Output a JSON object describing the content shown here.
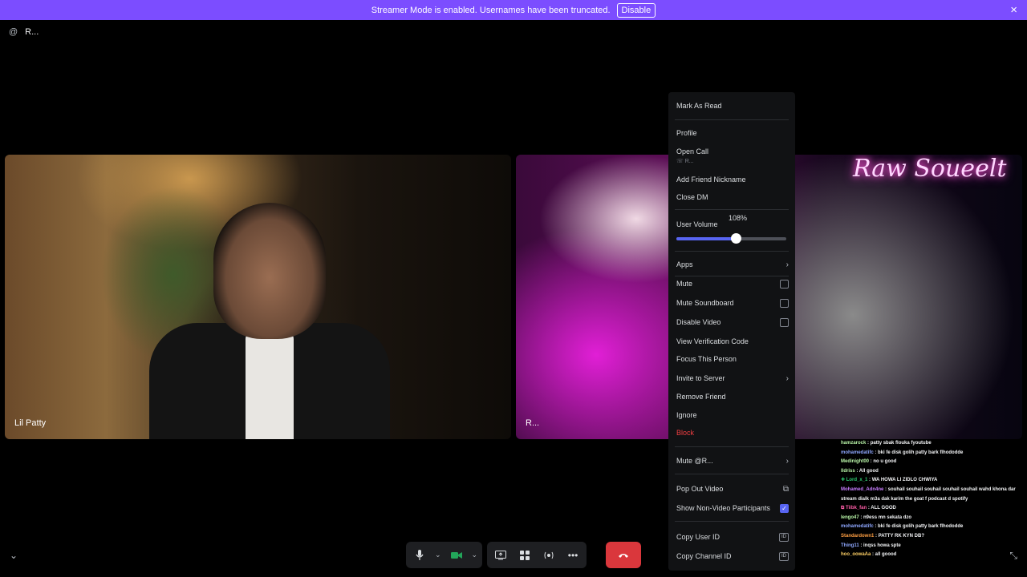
{
  "banner": {
    "message": "Streamer Mode is enabled. Usernames have been truncated.",
    "disable_label": "Disable",
    "close_icon": "×"
  },
  "dm_header": {
    "icon": "@",
    "name": "R..."
  },
  "tiles": [
    {
      "label": "Lil Patty"
    },
    {
      "label": "R...",
      "neon_sign": "Raw Soueelt"
    }
  ],
  "menu": {
    "mark_as_read": "Mark As Read",
    "profile": "Profile",
    "open_call": "Open Call",
    "open_call_sub": "R...",
    "add_friend_nickname": "Add Friend Nickname",
    "close_dm": "Close DM",
    "user_volume": "User Volume",
    "volume_value": "108%",
    "volume_fraction": 0.54,
    "apps": "Apps",
    "mute": "Mute",
    "mute_soundboard": "Mute Soundboard",
    "disable_video": "Disable Video",
    "view_verification_code": "View Verification Code",
    "focus_this_person": "Focus This Person",
    "invite_to_server": "Invite to Server",
    "remove_friend": "Remove Friend",
    "ignore": "Ignore",
    "block": "Block",
    "mute_user": "Mute @R...",
    "pop_out_video": "Pop Out Video",
    "show_non_video": "Show Non-Video Participants",
    "show_non_video_checked": true,
    "copy_user_id": "Copy User ID",
    "copy_channel_id": "Copy Channel ID",
    "id_badge": "ID"
  },
  "chat": [
    {
      "user": "hamzarock",
      "color": "#b9f5a8",
      "text": " : patty sbak flouka fyoutube"
    },
    {
      "user": "mohamedatifc",
      "color": "#8fa8ff",
      "text": " : bki fe disk golih patty bark flhododde"
    },
    {
      "user": "Medinight00",
      "color": "#b9f5a8",
      "text": " : no u good"
    },
    {
      "user": "lldriss",
      "color": "#b9f5a8",
      "text": " : All good"
    },
    {
      "user": "✚ Lord_x_1",
      "color": "#2ecc71",
      "text": " : WA HOWA LI ZIDLO CHWIYA"
    },
    {
      "user": "Mohamed_Adn4ne",
      "color": "#c77dff",
      "text": " : souhail souhail souhail souhail souhail wahd khona dar stream dialk m3a dak karim the goat f podcast d spotify"
    },
    {
      "user": "⧉ Tiibk_fan",
      "color": "#ff5ea8",
      "text": " : ALL GOOD"
    },
    {
      "user": "lengo47",
      "color": "#b9f5a8",
      "text": " : n9ess mn sekata dzo"
    },
    {
      "user": "mohamedatifc",
      "color": "#8fa8ff",
      "text": " : bki fe disk golih patty bark flhododde"
    },
    {
      "user": "Standardown1",
      "color": "#ff9f43",
      "text": " : PATTY RK KYN DB?"
    },
    {
      "user": "Thing11",
      "color": "#8fa8ff",
      "text": " : inqss howa spte"
    },
    {
      "user": "hoo_oowaAa",
      "color": "#ffd166",
      "text": " : all goood"
    }
  ]
}
